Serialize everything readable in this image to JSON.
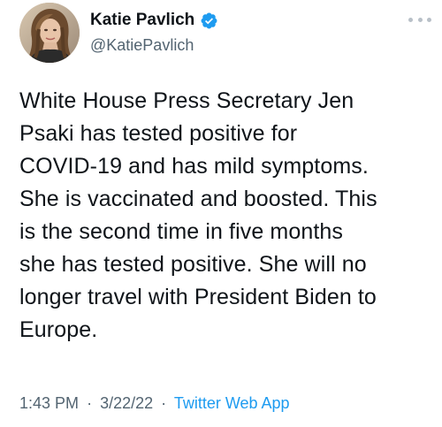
{
  "author": {
    "display_name": "Katie Pavlich",
    "handle": "@KatiePavlich",
    "verified": true
  },
  "tweet": {
    "text": "White House Press Secretary Jen\nPsaki has tested positive for\nCOVID-19 and has mild symptoms.\nShe is vaccinated and boosted. This\nis the second time in five months\nshe has tested positive. She will no\nlonger travel with President Biden to\nEurope.",
    "time": "1:43 PM",
    "separator": "·",
    "date": "3/22/22",
    "source": "Twitter Web App"
  },
  "colors": {
    "text": "#0f1419",
    "secondary": "#536471",
    "accent": "#1d9bf0"
  },
  "icons": {
    "verified": "verified-badge-icon",
    "more": "more-options-icon"
  }
}
